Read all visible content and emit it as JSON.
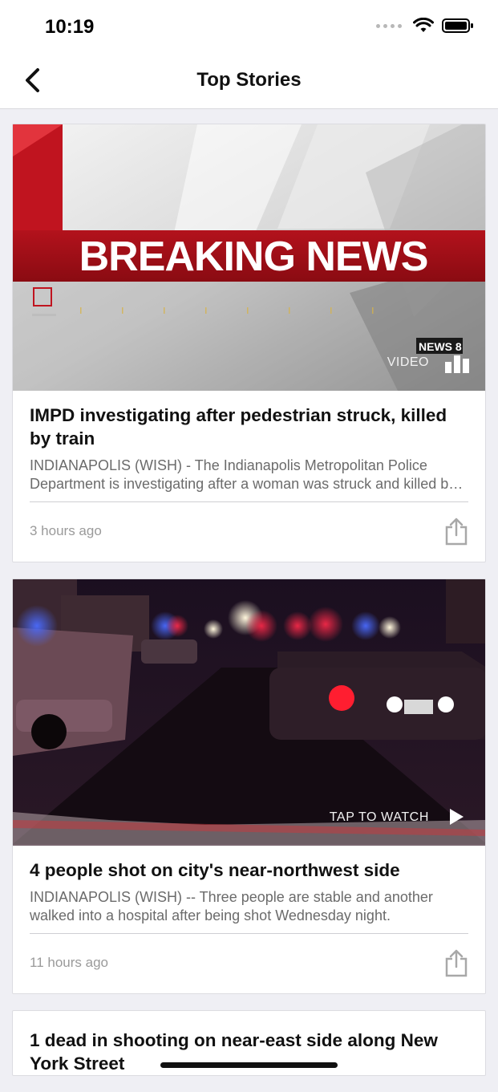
{
  "status_bar": {
    "time": "10:19"
  },
  "nav": {
    "title": "Top Stories"
  },
  "breaking_graphic": {
    "banner_text": "BREAKING NEWS",
    "logo_text": "NEWS 8"
  },
  "stories": [
    {
      "title": "IMPD investigating after pedestrian struck, killed by train",
      "summary": "INDIANAPOLIS (WISH) - The Indianapolis Metropolitan Police Department is investigating after a woman was struck and killed by a train.",
      "time": "3 hours ago",
      "media_label": "VIDEO"
    },
    {
      "title": "4 people shot on city's near-northwest side",
      "summary": "INDIANAPOLIS (WISH) -- Three people are stable and another walked into a hospital after being shot Wednesday night.",
      "time": "11 hours ago",
      "media_label": "TAP TO WATCH"
    },
    {
      "title": "1 dead in shooting on near-east side along New York Street"
    }
  ]
}
